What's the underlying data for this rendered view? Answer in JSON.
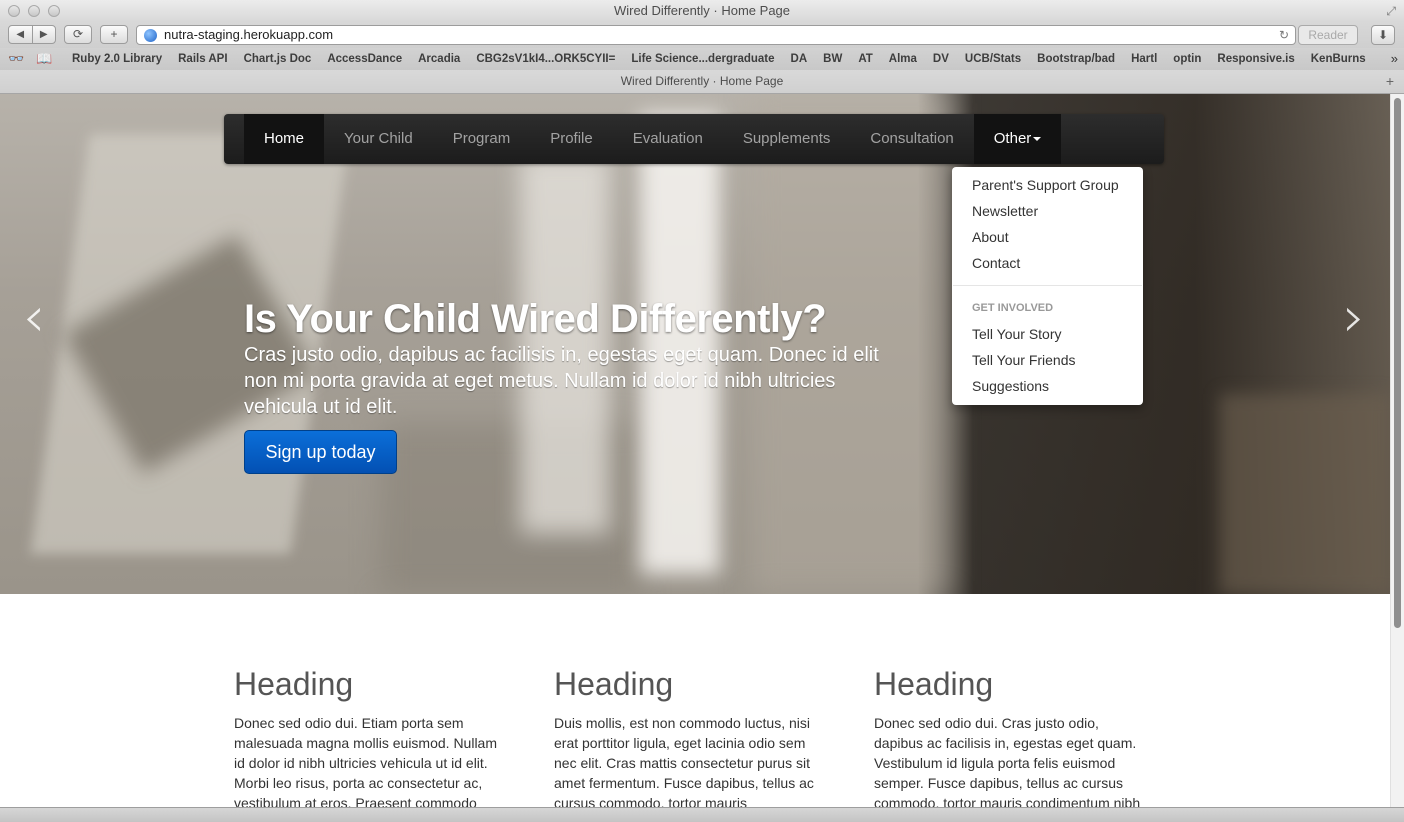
{
  "browser": {
    "window_title": "Wired Differently · Home Page",
    "url": "nutra-staging.herokuapp.com",
    "reader_label": "Reader",
    "tab_title": "Wired Differently · Home Page",
    "bookmarks": [
      "Ruby 2.0 Library",
      "Rails API",
      "Chart.js Doc",
      "AccessDance",
      "Arcadia",
      "CBG2sV1kI4...ORK5CYII=",
      "Life Science...dergraduate",
      "DA",
      "BW",
      "AT",
      "Alma",
      "DV",
      "UCB/Stats",
      "Bootstrap/bad",
      "Hartl",
      "optin",
      "Responsive.is",
      "KenBurns"
    ],
    "bookmarks_more": "»"
  },
  "navbar": {
    "items": [
      {
        "label": "Home",
        "state": "active"
      },
      {
        "label": "Your Child"
      },
      {
        "label": "Program"
      },
      {
        "label": "Profile"
      },
      {
        "label": "Evaluation"
      },
      {
        "label": "Supplements"
      },
      {
        "label": "Consultation"
      },
      {
        "label": "Other",
        "state": "open"
      }
    ]
  },
  "dropdown": {
    "items": [
      "Parent's Support Group",
      "Newsletter",
      "About",
      "Contact"
    ],
    "header": "GET INVOLVED",
    "involved_items": [
      "Tell Your Story",
      "Tell Your Friends",
      "Suggestions"
    ]
  },
  "hero": {
    "heading": "Is Your Child Wired Differently?",
    "text": "Cras justo odio, dapibus ac facilisis in, egestas eget quam. Donec id elit non mi porta gravida at eget metus. Nullam id dolor id nibh ultricies vehicula ut id elit.",
    "cta": "Sign up today",
    "prev": "‹",
    "next": "›"
  },
  "columns": [
    {
      "heading": "Heading",
      "text": "Donec sed odio dui. Etiam porta sem malesuada magna mollis euismod. Nullam id dolor id nibh ultricies vehicula ut id elit. Morbi leo risus, porta ac consectetur ac, vestibulum at eros. Praesent commodo"
    },
    {
      "heading": "Heading",
      "text": "Duis mollis, est non commodo luctus, nisi erat porttitor ligula, eget lacinia odio sem nec elit. Cras mattis consectetur purus sit amet fermentum. Fusce dapibus, tellus ac cursus commodo, tortor mauris"
    },
    {
      "heading": "Heading",
      "text": "Donec sed odio dui. Cras justo odio, dapibus ac facilisis in, egestas eget quam. Vestibulum id ligula porta felis euismod semper. Fusce dapibus, tellus ac cursus commodo, tortor mauris condimentum nibh"
    }
  ]
}
